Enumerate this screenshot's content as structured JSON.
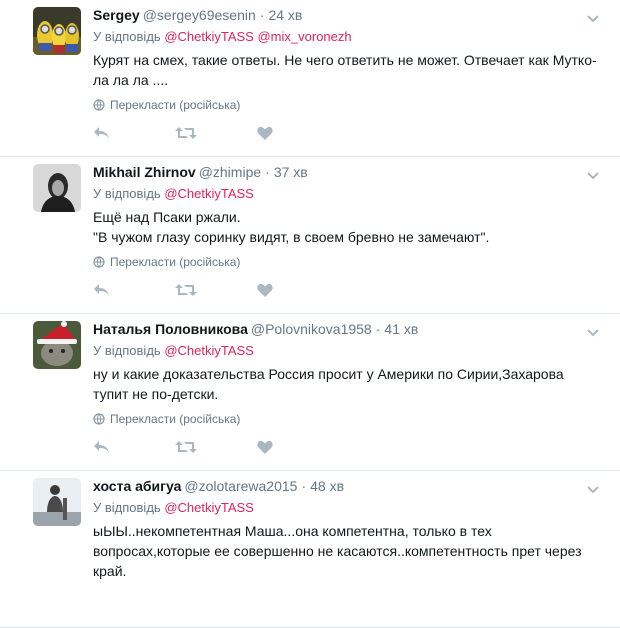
{
  "tweets": [
    {
      "name": "Sergey",
      "handle": "@sergey69esenin",
      "sep": "·",
      "time": "24 хв",
      "reply_prefix": "У відповідь",
      "reply_to_1": "@ChetkiyTASS",
      "reply_to_2": "@mix_voronezh",
      "text_lines": [
        "Курят на смех, такие ответы. Не чего ответить не может. Отвечает как Мутко-",
        "ла ла ла ...."
      ],
      "translate": "Перекласти (російська)"
    },
    {
      "name": "Mikhail Zhirnov",
      "handle": "@zhimipe",
      "sep": "·",
      "time": "37 хв",
      "reply_prefix": "У відповідь",
      "reply_to_1": "@ChetkiyTASS",
      "text_lines": [
        "Ещё над Псаки ржали.",
        "\"В чужом глазу соринку видят, в своем бревно не замечают\"."
      ],
      "translate": "Перекласти (російська)"
    },
    {
      "name": "Наталья Половникова",
      "handle": "@Polovnikova1958",
      "sep": "·",
      "time": "41 хв",
      "reply_prefix": "У відповідь",
      "reply_to_1": "@ChetkiyTASS",
      "text_lines": [
        "ну и какие доказательства Россия просит у Америки по Сирии,Захарова",
        "тупит не по-детски."
      ],
      "translate": "Перекласти (російська)"
    },
    {
      "name": "хоста абигуа",
      "handle": "@zolotarewa2015",
      "sep": "·",
      "time": "48 хв",
      "reply_prefix": "У відповідь",
      "reply_to_1": "@ChetkiyTASS",
      "text_lines": [
        "ыЫЫ..некомпетентная Маша...она компетентна, только в тех",
        "вопросах,которые ее совершенно не касаются..компетентность прет через",
        "край."
      ]
    }
  ],
  "icons": {
    "reply": "reply-icon",
    "retweet": "retweet-icon",
    "like": "heart-icon",
    "caret": "chevron-down-icon",
    "globe": "globe-icon"
  },
  "colors": {
    "accent": "#e0245e",
    "muted": "#657786",
    "icon": "#aab8c2",
    "border": "#e1e8ed"
  }
}
